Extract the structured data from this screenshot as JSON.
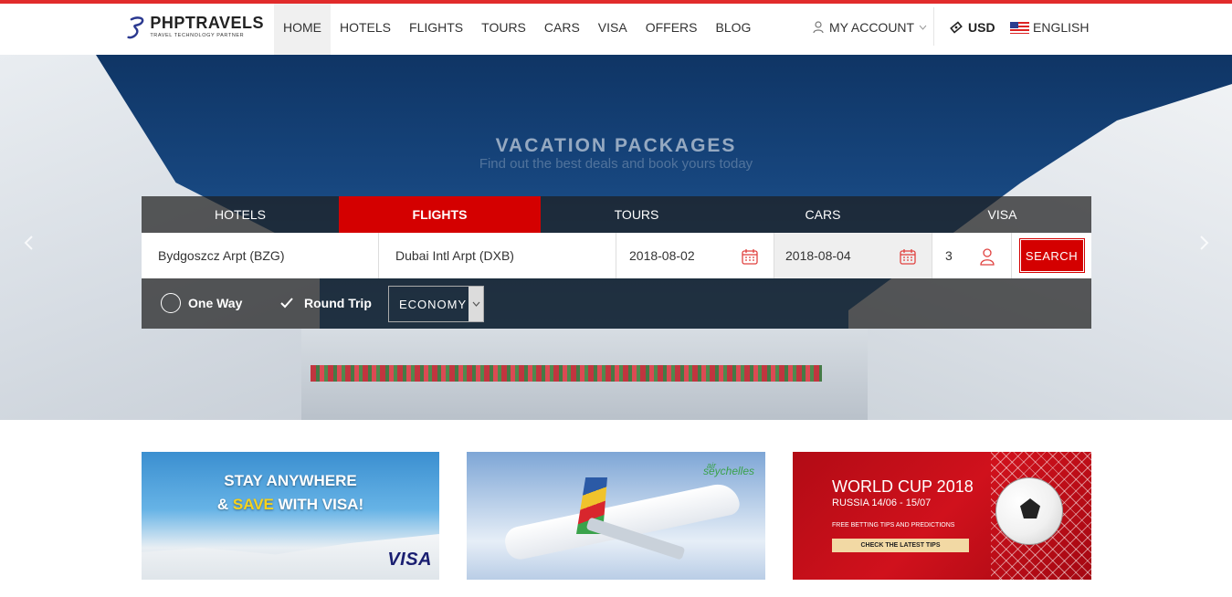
{
  "brand": {
    "name": "PHPTRAVELS",
    "tagline": "TRAVEL TECHNOLOGY PARTNER",
    "accent": "#d40000"
  },
  "nav": {
    "items": [
      "HOME",
      "HOTELS",
      "FLIGHTS",
      "TOURS",
      "CARS",
      "VISA",
      "OFFERS",
      "BLOG"
    ],
    "active": "HOME"
  },
  "account": {
    "label": "MY ACCOUNT"
  },
  "currency": {
    "label": "USD"
  },
  "language": {
    "label": "ENGLISH"
  },
  "hero": {
    "title": "VACATION PACKAGES",
    "subtitle": "Find out the best deals and book yours today"
  },
  "search": {
    "tabs": [
      "HOTELS",
      "FLIGHTS",
      "TOURS",
      "CARS",
      "VISA"
    ],
    "active_tab": "FLIGHTS",
    "from": "Bydgoszcz Arpt (BZG)",
    "to": "Dubai Intl Arpt (DXB)",
    "depart": "2018-08-02",
    "return": "2018-08-04",
    "passengers": "3",
    "search_label": "SEARCH",
    "one_way": "One Way",
    "round_trip": "Round Trip",
    "trip_type": "Round Trip",
    "cabin_class": "ECONOMY"
  },
  "cards": {
    "visa": {
      "line1": "STAY ANYWHERE",
      "line2_pre": "& ",
      "line2_hl": "SAVE",
      "line2_post": " WITH VISA!",
      "brand": "VISA"
    },
    "airline": {
      "prefix": "air",
      "name": "seychelles"
    },
    "worldcup": {
      "title": "WORLD CUP 2018",
      "subtitle": "RUSSIA 14/06 - 15/07",
      "note": "FREE BETTING TIPS AND PREDICTIONS",
      "button": "CHECK THE LATEST TIPS"
    }
  }
}
